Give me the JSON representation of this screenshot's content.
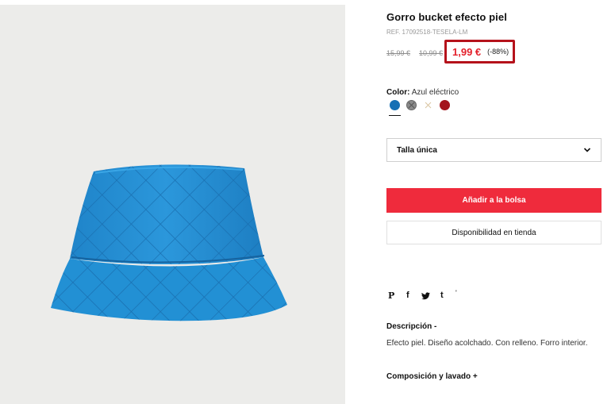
{
  "product": {
    "name": "Gorro bucket efecto piel",
    "ref": "REF. 17092518-TESELA-LM",
    "old_price_1": "15,99 €",
    "old_price_2": "10,99 €",
    "price": "1,99 €",
    "discount": "(-88%)"
  },
  "color": {
    "label": "Color:",
    "value": "Azul eléctrico",
    "swatches": [
      "#1670b5",
      "#8a8a8a",
      "#d9c5a0",
      "#a3141c"
    ]
  },
  "size": {
    "selected": "Talla única",
    "icon": "chevron-down-icon"
  },
  "actions": {
    "add_to_bag": "Añadir a la bolsa",
    "store_availability": "Disponibilidad en tienda"
  },
  "share": {
    "icons": [
      "pinterest-icon",
      "facebook-icon",
      "twitter-icon",
      "tumblr-icon"
    ],
    "pinterest": "P",
    "facebook": "f",
    "tumblr": "t",
    "extra": "'"
  },
  "description": {
    "title": "Descripción  -",
    "text": "Efecto piel. Diseño acolchado. Con relleno. Forro interior."
  },
  "composition": {
    "title": "Composición y lavado  +"
  },
  "colors": {
    "accent": "#ef2b3c",
    "price_red": "#e3202b",
    "highlight_border": "#b5121b"
  }
}
